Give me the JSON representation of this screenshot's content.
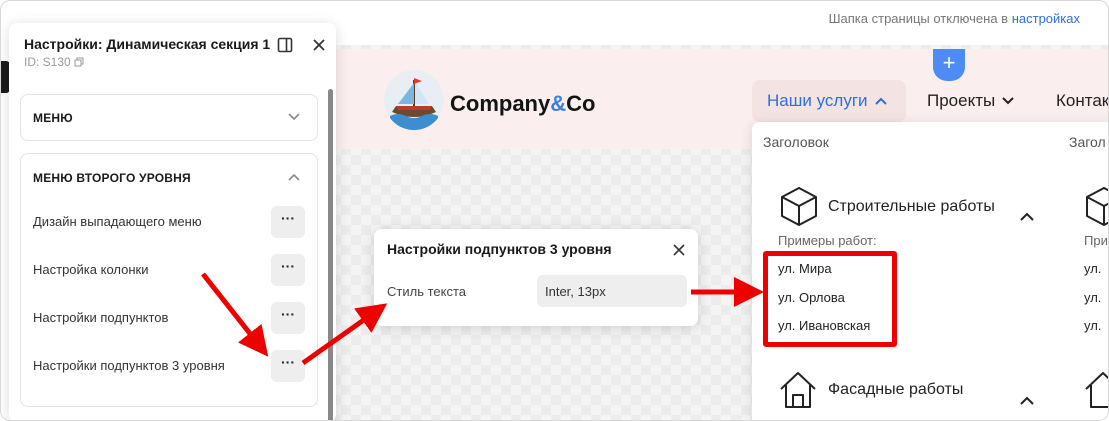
{
  "top_note": {
    "text": "Шапка страницы отключена в ",
    "link": "настройках"
  },
  "site": {
    "brand_main": "Company",
    "brand_amp": "&",
    "brand_end": "Co",
    "plus_label": "+",
    "nav": [
      {
        "label": "Наши услуги",
        "active": true
      },
      {
        "label": "Проекты",
        "active": false
      },
      {
        "label": "Контак",
        "active": false
      }
    ],
    "dropdown": {
      "heading_left": "Заголовок",
      "heading_right": "Загол",
      "category1": "Строительные работы",
      "examples_label": "Примеры работ:",
      "examples_right": "При",
      "streets": [
        "ул. Мира",
        "ул. Орлова",
        "ул. Ивановская"
      ],
      "streets_right": [
        "ул.",
        "ул.",
        "ул."
      ],
      "category2": "Фасадные работы"
    }
  },
  "panel": {
    "title": "Настройки: Динамическая секция 1",
    "id_text": "ID: S130",
    "menu_card_title": "МЕНЮ",
    "second_card_title": "МЕНЮ ВТОРОГО УРОВНЯ",
    "rows": [
      "Дизайн выпадающего меню",
      "Настройка колонки",
      "Настройки подпунктов",
      "Настройки подпунктов 3 уровня"
    ],
    "dots_label": "···"
  },
  "popup": {
    "title": "Настройки подпунктов 3 уровня",
    "label": "Стиль текста",
    "value": "Inter, 13px"
  },
  "colors": {
    "accent": "#2f6fd6",
    "highlight": "#ee0000",
    "header_bg": "#fbeeee"
  }
}
